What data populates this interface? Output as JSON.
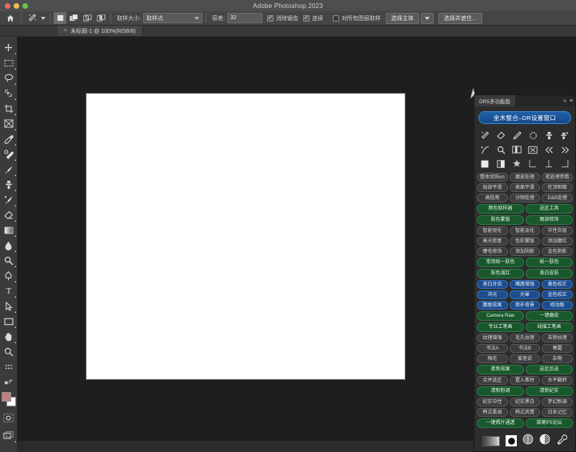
{
  "window": {
    "app_title": "Adobe Photoshop 2023",
    "traffic_lights": [
      "close-red",
      "minimize-yellow",
      "maximize-green"
    ]
  },
  "options_bar": {
    "home_icon": "home-icon",
    "tool_icon": "magic-wand-icon",
    "tool_dropdown_caret": "chevron-down-icon",
    "selection_modes": [
      "new-selection",
      "add-to-selection",
      "subtract-from-selection",
      "intersect-selection"
    ],
    "sample_size_label": "取样大小:",
    "sample_size_value": "取样点",
    "tolerance_label": "容差:",
    "tolerance_value": "32",
    "antialias_label": "消除锯齿",
    "antialias_checked": true,
    "contiguous_label": "连续",
    "contiguous_checked": true,
    "all_layers_label": "对所有图层取样",
    "all_layers_checked": false,
    "select_subject_label": "选择主体",
    "select_subject_caret": "chevron-down-icon",
    "select_and_mask_label": "选择并遮住..."
  },
  "tab_bar": {
    "tabs": [
      {
        "title": "未标题-1 @ 100%(RGB/8)",
        "close": "×",
        "active": true
      }
    ]
  },
  "toolbar": {
    "tools": [
      {
        "name": "move-tool",
        "glyph": "move"
      },
      {
        "name": "rectangular-marquee-tool",
        "glyph": "marquee"
      },
      {
        "name": "lasso-tool",
        "glyph": "lasso"
      },
      {
        "name": "object-selection-tool",
        "glyph": "objsel"
      },
      {
        "name": "crop-tool",
        "glyph": "crop"
      },
      {
        "name": "frame-tool",
        "glyph": "frame"
      },
      {
        "name": "eyedropper-tool",
        "glyph": "eyedropper"
      },
      {
        "name": "spot-healing-brush-tool",
        "glyph": "healing"
      },
      {
        "name": "brush-tool",
        "glyph": "brush"
      },
      {
        "name": "clone-stamp-tool",
        "glyph": "stamp"
      },
      {
        "name": "history-brush-tool",
        "glyph": "historybrush"
      },
      {
        "name": "eraser-tool",
        "glyph": "eraser"
      },
      {
        "name": "gradient-tool",
        "glyph": "gradient"
      },
      {
        "name": "blur-tool",
        "glyph": "blur"
      },
      {
        "name": "dodge-tool",
        "glyph": "dodge"
      },
      {
        "name": "pen-tool",
        "glyph": "pen"
      },
      {
        "name": "type-tool",
        "glyph": "type"
      },
      {
        "name": "path-selection-tool",
        "glyph": "pathsel"
      },
      {
        "name": "rectangle-tool",
        "glyph": "rectangle"
      },
      {
        "name": "hand-tool",
        "glyph": "hand"
      },
      {
        "name": "zoom-tool",
        "glyph": "zoom"
      },
      {
        "name": "edit-toolbar-tool",
        "glyph": "dots"
      }
    ],
    "foreground_color": "#c08080",
    "background_color": "#ffffff",
    "quick_mask_name": "quick-mask-icon",
    "screen_mode_name": "screen-mode-icon"
  },
  "panel": {
    "tab_title": "DR5多功能版",
    "collapse_icon": "»",
    "menu_icon": "≡",
    "primary_button": "金木整合–DR设置窗口",
    "icon_rows": [
      [
        "wand-icon",
        "eraser-icon",
        "pencil-icon",
        "circle-icon",
        "stamp-icon",
        "stamp-plus-icon"
      ],
      [
        "curve-icon",
        "search-icon",
        "compare-icon",
        "transform-icon",
        "prev-icon",
        "next-icon"
      ],
      [
        "square-icon",
        "halfsquare-icon",
        "star-icon",
        "align-left-icon",
        "align-center-icon",
        "align-right-icon"
      ]
    ],
    "groups": [
      {
        "name": "retouch-tools-group",
        "style": "gray",
        "cols": 3,
        "buttons": [
          "整体润饰on",
          "磨皮处理",
          "批处理参数",
          "局部平滑",
          "表面平滑",
          "柱顶明暗",
          "高低频",
          "分频处理",
          "D&B处理"
        ]
      },
      {
        "name": "color-sampler-group",
        "style": "green",
        "cols": 2,
        "buttons": [
          "颜色取样器",
          "选区工具",
          "肤色蒙版",
          "眼部修饰"
        ]
      },
      {
        "name": "smart-sharpen-group",
        "style": "gray",
        "cols": 3,
        "buttons": [
          "智能锐化",
          "智能淡化",
          "中性灰层",
          "高光修复",
          "色彩蒙版",
          "添加腮红",
          "睫毛修饰",
          "添加阴影",
          "金色阴影"
        ]
      },
      {
        "name": "skin-unify-group",
        "style": "green",
        "cols": 2,
        "buttons": [
          "常用统一肤色",
          "统一肤色",
          "肤色减红",
          "美白皮肤"
        ]
      },
      {
        "name": "whiten-group",
        "style": "blue",
        "cols": 3,
        "buttons": [
          "美白牙齿",
          "嘴唇增强",
          "黄色校正",
          "冲光",
          "光晕",
          "金色校正",
          "朦胧效果",
          "修补背景",
          "修动版"
        ]
      },
      {
        "name": "camera-raw-group",
        "style": "green",
        "cols": 2,
        "buttons": [
          "Camera Raw",
          "一键磨皮",
          "专业工笔画",
          "线描工笔画"
        ]
      },
      {
        "name": "texture-group",
        "style": "gray",
        "cols": 3,
        "buttons": [
          "纹理增强",
          "毛孔纹理",
          "去除纹理",
          "书法A",
          "书法B",
          "寒霜",
          "梅花",
          "爱莲说",
          "杂物"
        ]
      },
      {
        "name": "focus-group",
        "style": "green",
        "cols": 2,
        "buttons": [
          "柔焦效果",
          "选区反选"
        ]
      },
      {
        "name": "merge-group",
        "style": "gray",
        "cols": 3,
        "buttons": [
          "合并选区",
          "置入素材",
          "水平翻转"
        ]
      },
      {
        "name": "tone-group",
        "style": "green",
        "cols": 2,
        "buttons": [
          "清新粉调",
          "清新纪实"
        ]
      },
      {
        "name": "style-group",
        "style": "gray",
        "cols": 3,
        "buttons": [
          "纪实中性",
          "纪实黑白",
          "梦幻粉调",
          "韩式柔调",
          "韩式风情",
          "日系记忆"
        ]
      },
      {
        "name": "onekey-group",
        "style": "green",
        "cols": 2,
        "buttons": [
          "一键照片通透",
          "菜莫PS论坛"
        ]
      }
    ],
    "bottom_icons": [
      "gradient-swatch-icon",
      "solid-circle-icon",
      "half-tone-circle-icon",
      "contrast-circle-icon",
      "wrench-icon"
    ]
  }
}
